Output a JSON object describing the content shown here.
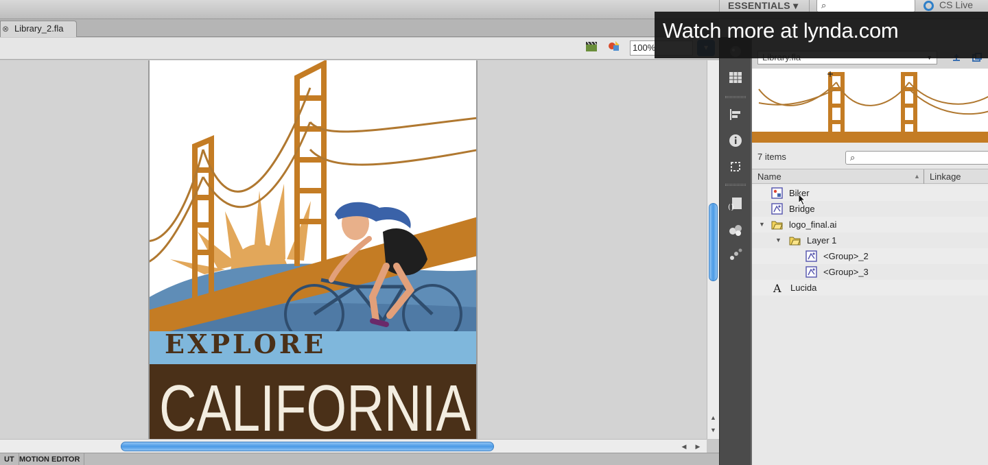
{
  "app": {
    "workspace_label": "ESSENTIALS ▾",
    "cs_live_label": "CS Live",
    "search_icon": "magnifier-icon"
  },
  "document": {
    "tab_label": "Library_2.fla",
    "close_glyph": "⊗"
  },
  "editbar": {
    "zoom_value": "100%",
    "zoom_button": "▾"
  },
  "artwork": {
    "headline_top": "EXPLORE",
    "headline_bottom": "CALIFORNIA",
    "colors": {
      "bridge": "#c47c24",
      "sky_blue": "#7fb7dc",
      "hill_blue": "#5f8db7",
      "sun": "#e2a75a",
      "brown": "#4a3018",
      "cream": "#f3ede0"
    }
  },
  "bottom_tabs": [
    "UT",
    "MOTION EDITOR"
  ],
  "library": {
    "file_select": "Library.fla",
    "item_count": "7 items",
    "columns": {
      "name": "Name",
      "linkage": "Linkage"
    },
    "items": [
      {
        "label": "Biker",
        "icon": "movieclip-icon",
        "expander": ""
      },
      {
        "label": "Bridge",
        "icon": "graphic-icon",
        "expander": ""
      },
      {
        "label": "logo_final.ai",
        "icon": "folder-icon",
        "expander": "▼"
      },
      {
        "label": "Layer 1",
        "icon": "folder-icon",
        "expander": "▼"
      },
      {
        "label": "<Group>_2",
        "icon": "graphic-icon",
        "expander": ""
      },
      {
        "label": "<Group>_3",
        "icon": "graphic-icon",
        "expander": ""
      },
      {
        "label": "Lucida",
        "icon": "font-icon",
        "expander": ""
      }
    ]
  },
  "overlay": {
    "text": "Watch more at lynda.com"
  }
}
